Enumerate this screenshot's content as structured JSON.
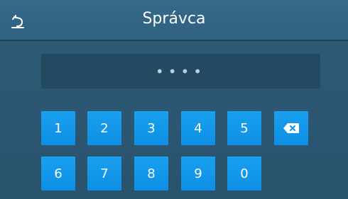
{
  "header": {
    "title": "Správca",
    "back_icon": "back-arrow-icon"
  },
  "pin": {
    "masked_value": "••••"
  },
  "keypad": {
    "row1": [
      "1",
      "2",
      "3",
      "4",
      "5"
    ],
    "row2": [
      "6",
      "7",
      "8",
      "9",
      "0"
    ],
    "backspace_icon": "backspace-icon"
  },
  "colors": {
    "background": "#2b5570",
    "header": "#356a8a",
    "key": "#1597ea",
    "pin_field": "#234a60"
  }
}
